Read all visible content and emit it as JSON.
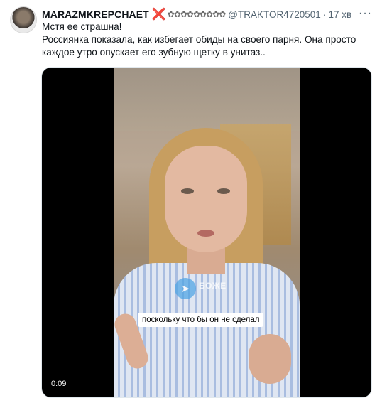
{
  "tweet": {
    "author_name": "MARAZMKREPCHAET",
    "author_badge": "❌",
    "author_decor": "✿✿✿✿✿✿✿✿✿",
    "handle": "@TRAKTOR4720501",
    "separator": "·",
    "time": "17 хв",
    "more_icon": "···",
    "text_line1": "Мстя ее страшна!",
    "text_line2": "Россиянка показала, как избегает обиды на своего парня. Она просто каждое утро опускает его зубную щетку в унитаз..",
    "media": {
      "caption": "поскольку что бы он не сделал",
      "watermark": "БОЖЕ",
      "duration": "0:09"
    }
  },
  "colors": {
    "accent": "#4aa3e4",
    "secondary_text": "#536471",
    "badge": "#e0245e"
  }
}
